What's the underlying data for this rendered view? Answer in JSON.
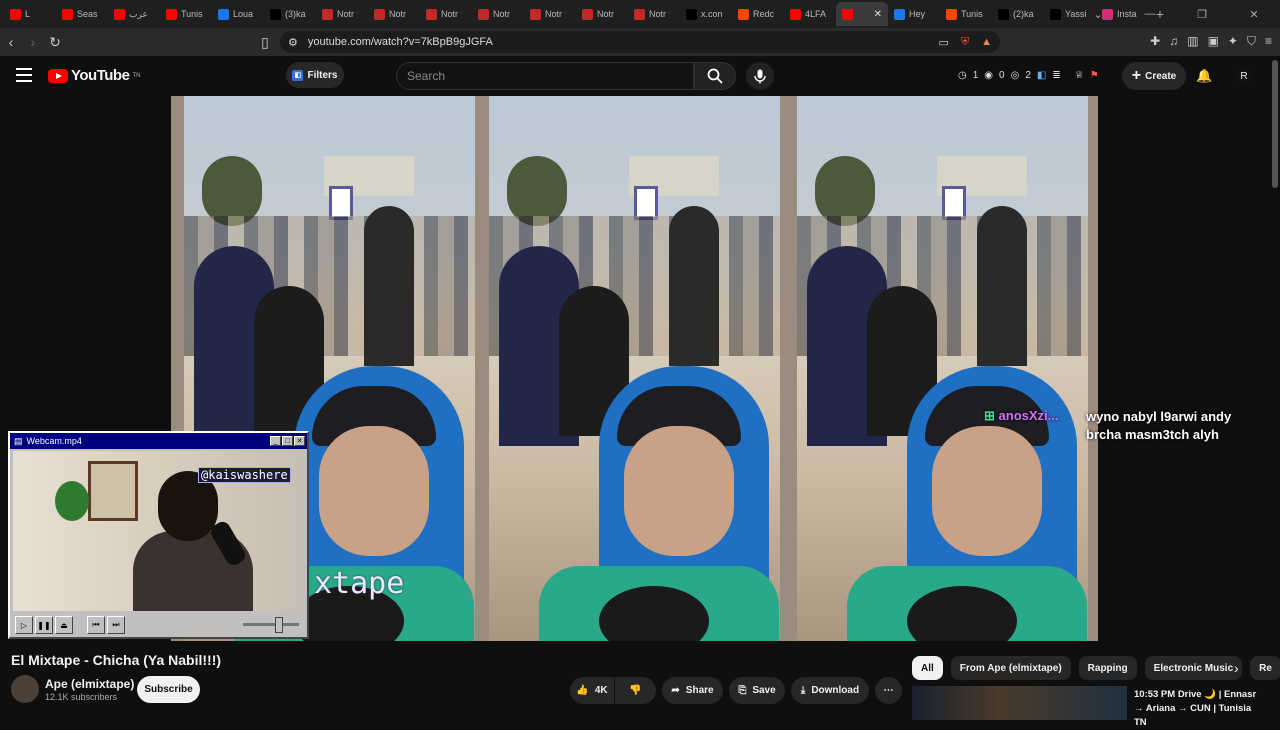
{
  "browser": {
    "tabs": [
      {
        "label": "L",
        "icon": "youtube-icon",
        "color": "#ff0000"
      },
      {
        "label": "Seas",
        "icon": "youtube-icon",
        "color": "#ff0000"
      },
      {
        "label": "عرب",
        "icon": "youtube-icon",
        "color": "#ff0000"
      },
      {
        "label": "Tunis",
        "icon": "youtube-icon",
        "color": "#ff0000"
      },
      {
        "label": "Loua",
        "icon": "facebook-icon",
        "color": "#1877f2"
      },
      {
        "label": "(3)ka",
        "icon": "tiktok-icon",
        "color": "#000000"
      },
      {
        "label": "Notr",
        "icon": "notr-icon",
        "color": "#c62828"
      },
      {
        "label": "Notr",
        "icon": "notr-icon",
        "color": "#c62828"
      },
      {
        "label": "Notr",
        "icon": "notr-icon",
        "color": "#c62828"
      },
      {
        "label": "Notr",
        "icon": "notr-icon",
        "color": "#c62828"
      },
      {
        "label": "Notr",
        "icon": "notr-icon",
        "color": "#c62828"
      },
      {
        "label": "Notr",
        "icon": "notr-icon",
        "color": "#c62828"
      },
      {
        "label": "Notr",
        "icon": "notr-icon",
        "color": "#c62828"
      },
      {
        "label": "x.con",
        "icon": "x-icon",
        "color": "#000000"
      },
      {
        "label": "Redc",
        "icon": "reddit-icon",
        "color": "#ff4500"
      },
      {
        "label": "4LFA",
        "icon": "youtube-icon",
        "color": "#ff0000"
      },
      {
        "label": "",
        "icon": "youtube-icon",
        "color": "#ff0000",
        "active": true
      },
      {
        "label": "Hey",
        "icon": "facebook-icon",
        "color": "#1877f2"
      },
      {
        "label": "Tunis",
        "icon": "reddit-icon",
        "color": "#ff4500"
      },
      {
        "label": "(2)ka",
        "icon": "tiktok-icon",
        "color": "#000000"
      },
      {
        "label": "Yassi",
        "icon": "tiktok-icon",
        "color": "#000000"
      },
      {
        "label": "Insta",
        "icon": "instagram-icon",
        "color": "#d62976"
      }
    ],
    "new_tab": "+",
    "url": "youtube.com/watch?v=7kBpB9gJGFA"
  },
  "youtube": {
    "logo_text": "YouTube",
    "logo_region": "TN",
    "filters_label": "Filters",
    "search_placeholder": "Search",
    "stats": [
      "1",
      "0",
      "2"
    ],
    "create_label": "Create",
    "avatar_letter": "R"
  },
  "video": {
    "watermark": "xtape",
    "chat_user": "anosXzi...",
    "chat_message": "wyno nabyl l9arwi andy brcha masm3tch alyh"
  },
  "webcam": {
    "title": "Webcam.mp4",
    "tag": "@kaiswashere"
  },
  "info": {
    "title": "El Mixtape - Chicha (Ya Nabil!!!)",
    "channel": "Ape (elmixtape)",
    "subscribers": "12.1K subscribers",
    "subscribe_label": "Subscribe",
    "likes": "4K",
    "share_label": "Share",
    "save_label": "Save",
    "download_label": "Download"
  },
  "chips": [
    "All",
    "From Ape (elmixtape)",
    "Rapping",
    "Electronic Music",
    "Re"
  ],
  "recommendation": {
    "title": "10:53 PM Drive 🌙 | Ennasr → Ariana → CUN | Tunisia TN"
  }
}
